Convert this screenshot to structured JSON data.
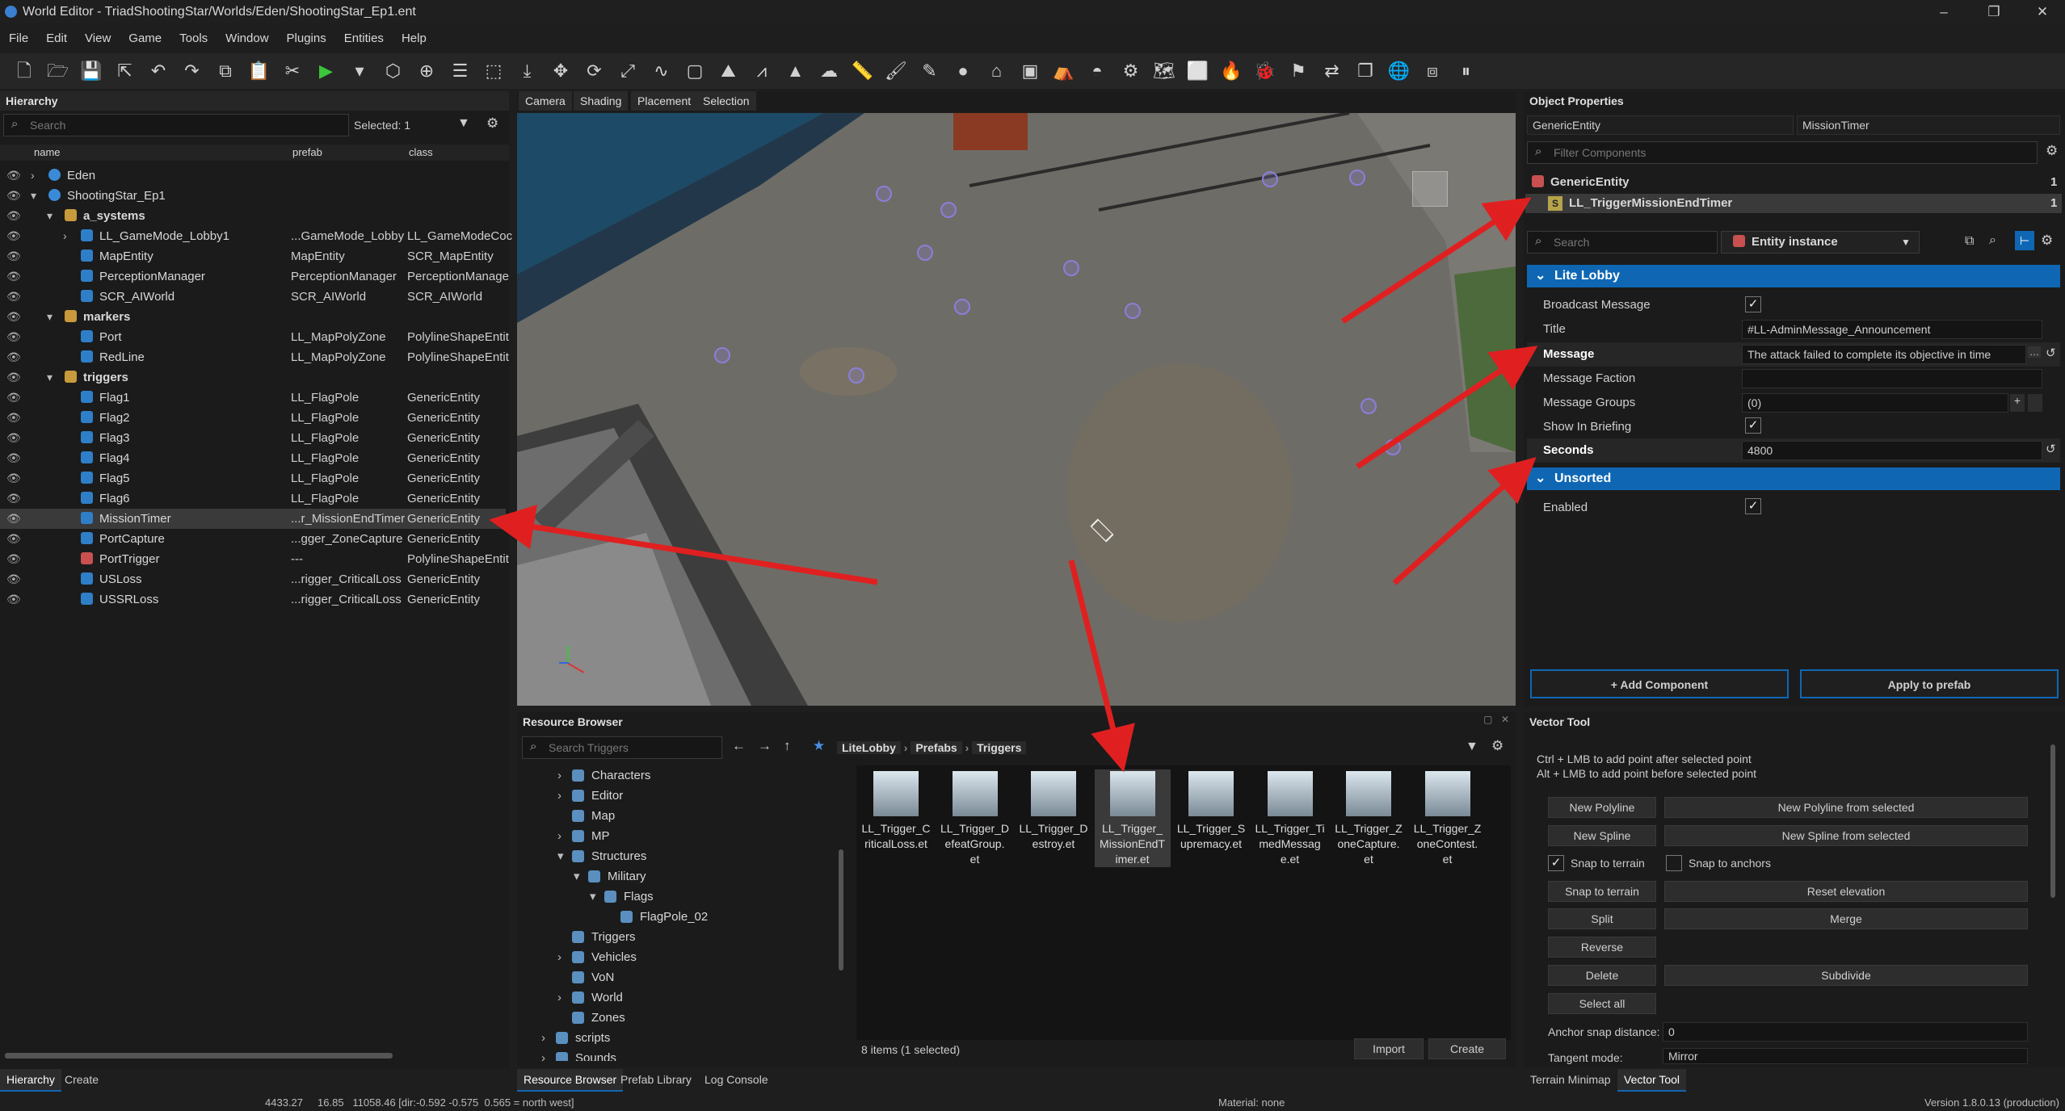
{
  "window": {
    "title": "World Editor - TriadShootingStar/Worlds/Eden/ShootingStar_Ep1.ent",
    "controls": [
      "–",
      "❐",
      "✕"
    ]
  },
  "menu": [
    "File",
    "Edit",
    "View",
    "Game",
    "Tools",
    "Window",
    "Plugins",
    "Entities",
    "Help"
  ],
  "toolbar_icons": [
    "new-file",
    "open-folder",
    "save",
    "export",
    "undo",
    "redo",
    "copy",
    "paste",
    "cut",
    "play",
    "play-options",
    "cube",
    "crosshair",
    "layers",
    "select-rect",
    "snap",
    "move",
    "rotate",
    "scale",
    "spline",
    "selection-box",
    "terrain",
    "mountain",
    "triangle",
    "weather",
    "ruler",
    "brush",
    "paint",
    "sphere",
    "house",
    "box",
    "tent",
    "dome",
    "gears",
    "map",
    "frame",
    "fire",
    "bug",
    "flag",
    "arrows",
    "windows",
    "globe",
    "stack",
    "pause"
  ],
  "hierarchy": {
    "title": "Hierarchy",
    "search_placeholder": "Search",
    "selected": "Selected: 1",
    "columns": [
      "name",
      "prefab",
      "class"
    ],
    "rows": [
      {
        "name": "Eden",
        "prefab": "",
        "class": "",
        "icon": "globe",
        "depth": 0,
        "arrow": "›"
      },
      {
        "name": "ShootingStar_Ep1",
        "prefab": "",
        "class": "",
        "icon": "globe",
        "depth": 0,
        "arrow": "▾"
      },
      {
        "name": "a_systems",
        "prefab": "",
        "class": "",
        "icon": "folder",
        "depth": 1,
        "arrow": "▾"
      },
      {
        "name": "LL_GameMode_Lobby1",
        "prefab": "...GameMode_Lobby",
        "class": "LL_GameModeCoc",
        "icon": "cube",
        "depth": 2,
        "arrow": "›"
      },
      {
        "name": "MapEntity",
        "prefab": "MapEntity",
        "class": "SCR_MapEntity",
        "icon": "cube",
        "depth": 2,
        "arrow": ""
      },
      {
        "name": "PerceptionManager",
        "prefab": "PerceptionManager",
        "class": "PerceptionManage",
        "icon": "cube",
        "depth": 2,
        "arrow": ""
      },
      {
        "name": "SCR_AIWorld",
        "prefab": "SCR_AIWorld",
        "class": "SCR_AIWorld",
        "icon": "cube",
        "depth": 2,
        "arrow": ""
      },
      {
        "name": "markers",
        "prefab": "",
        "class": "",
        "icon": "folder",
        "depth": 1,
        "arrow": "▾"
      },
      {
        "name": "Port",
        "prefab": "LL_MapPolyZone",
        "class": "PolylineShapeEntit",
        "icon": "cube",
        "depth": 2,
        "arrow": ""
      },
      {
        "name": "RedLine",
        "prefab": "LL_MapPolyZone",
        "class": "PolylineShapeEntit",
        "icon": "cube",
        "depth": 2,
        "arrow": ""
      },
      {
        "name": "triggers",
        "prefab": "",
        "class": "",
        "icon": "folder",
        "depth": 1,
        "arrow": "▾"
      },
      {
        "name": "Flag1",
        "prefab": "LL_FlagPole",
        "class": "GenericEntity",
        "icon": "cube",
        "depth": 2,
        "arrow": ""
      },
      {
        "name": "Flag2",
        "prefab": "LL_FlagPole",
        "class": "GenericEntity",
        "icon": "cube",
        "depth": 2,
        "arrow": ""
      },
      {
        "name": "Flag3",
        "prefab": "LL_FlagPole",
        "class": "GenericEntity",
        "icon": "cube",
        "depth": 2,
        "arrow": ""
      },
      {
        "name": "Flag4",
        "prefab": "LL_FlagPole",
        "class": "GenericEntity",
        "icon": "cube",
        "depth": 2,
        "arrow": ""
      },
      {
        "name": "Flag5",
        "prefab": "LL_FlagPole",
        "class": "GenericEntity",
        "icon": "cube",
        "depth": 2,
        "arrow": ""
      },
      {
        "name": "Flag6",
        "prefab": "LL_FlagPole",
        "class": "GenericEntity",
        "icon": "cube",
        "depth": 2,
        "arrow": ""
      },
      {
        "name": "MissionTimer",
        "prefab": "...r_MissionEndTimer",
        "class": "GenericEntity",
        "icon": "cube",
        "depth": 2,
        "arrow": "",
        "selected": true
      },
      {
        "name": "PortCapture",
        "prefab": "...gger_ZoneCapture",
        "class": "GenericEntity",
        "icon": "cube",
        "depth": 2,
        "arrow": ""
      },
      {
        "name": "PortTrigger",
        "prefab": "---",
        "class": "PolylineShapeEntit",
        "icon": "red",
        "depth": 2,
        "arrow": ""
      },
      {
        "name": "USLoss",
        "prefab": "...rigger_CriticalLoss",
        "class": "GenericEntity",
        "icon": "cube",
        "depth": 2,
        "arrow": ""
      },
      {
        "name": "USSRLoss",
        "prefab": "...rigger_CriticalLoss",
        "class": "GenericEntity",
        "icon": "cube",
        "depth": 2,
        "arrow": ""
      }
    ],
    "bottom_tabs": [
      "Hierarchy",
      "Create"
    ]
  },
  "viewport": {
    "tabs": [
      "Camera",
      "Shading",
      "Placement",
      "Selection"
    ]
  },
  "properties": {
    "title": "Object Properties",
    "entity_type": "GenericEntity",
    "entity_name": "MissionTimer",
    "filter_placeholder": "Filter Components",
    "components": [
      {
        "name": "GenericEntity",
        "count": "1"
      },
      {
        "name": "LL_TriggerMissionEndTimer",
        "count": "1",
        "badge": "S"
      }
    ],
    "search_placeholder": "Search",
    "instance_mode": "Entity instance",
    "section_lobby": "Lite Lobby",
    "section_unsorted": "Unsorted",
    "labels": {
      "broadcast": "Broadcast Message",
      "title": "Title",
      "message": "Message",
      "faction": "Message Faction",
      "groups": "Message Groups",
      "briefing": "Show In Briefing",
      "seconds": "Seconds",
      "enabled": "Enabled"
    },
    "values": {
      "title": "#LL-AdminMessage_Announcement",
      "message": "The attack failed to complete its objective in time",
      "faction": "",
      "groups": "(0)",
      "seconds": "4800"
    },
    "add_component": "+ Add Component",
    "apply_prefab": "Apply to prefab"
  },
  "resource_browser": {
    "title": "Resource Browser",
    "search_placeholder": "Search Triggers",
    "breadcrumb": [
      "LiteLobby",
      "Prefabs",
      "Triggers"
    ],
    "tree": [
      {
        "label": "Characters",
        "depth": 1,
        "arrow": "›"
      },
      {
        "label": "Editor",
        "depth": 1,
        "arrow": "›"
      },
      {
        "label": "Map",
        "depth": 1,
        "arrow": ""
      },
      {
        "label": "MP",
        "depth": 1,
        "arrow": "›"
      },
      {
        "label": "Structures",
        "depth": 1,
        "arrow": "▾"
      },
      {
        "label": "Military",
        "depth": 2,
        "arrow": "▾"
      },
      {
        "label": "Flags",
        "depth": 3,
        "arrow": "▾"
      },
      {
        "label": "FlagPole_02",
        "depth": 4,
        "arrow": ""
      },
      {
        "label": "Triggers",
        "depth": 1,
        "arrow": "",
        "selected": true
      },
      {
        "label": "Vehicles",
        "depth": 1,
        "arrow": "›"
      },
      {
        "label": "VoN",
        "depth": 1,
        "arrow": ""
      },
      {
        "label": "World",
        "depth": 1,
        "arrow": "›"
      },
      {
        "label": "Zones",
        "depth": 1,
        "arrow": ""
      },
      {
        "label": "scripts",
        "depth": 0,
        "arrow": "›"
      },
      {
        "label": "Sounds",
        "depth": 0,
        "arrow": "›"
      }
    ],
    "assets": [
      {
        "l1": "LL_Trigger_C",
        "l2": "riticalLoss.et",
        "l3": ""
      },
      {
        "l1": "LL_Trigger_D",
        "l2": "efeatGroup.",
        "l3": "et"
      },
      {
        "l1": "LL_Trigger_D",
        "l2": "estroy.et",
        "l3": ""
      },
      {
        "l1": "LL_Trigger_",
        "l2": "MissionEndT",
        "l3": "imer.et",
        "selected": true
      },
      {
        "l1": "LL_Trigger_S",
        "l2": "upremacy.et",
        "l3": ""
      },
      {
        "l1": "LL_Trigger_Ti",
        "l2": "medMessag",
        "l3": "e.et"
      },
      {
        "l1": "LL_Trigger_Z",
        "l2": "oneCapture.",
        "l3": "et"
      },
      {
        "l1": "LL_Trigger_Z",
        "l2": "oneContest.",
        "l3": "et"
      }
    ],
    "count": "8 items (1 selected)",
    "import": "Import",
    "create": "Create",
    "bottom_tabs": [
      "Resource Browser",
      "Prefab Library",
      "Log Console"
    ]
  },
  "vector_tool": {
    "title": "Vector Tool",
    "hint1": "Ctrl + LMB to add point after selected point",
    "hint2": "Alt + LMB to add point before selected point",
    "buttons": {
      "new_polyline": "New Polyline",
      "new_polyline_sel": "New Polyline from selected",
      "new_spline": "New Spline",
      "new_spline_sel": "New Spline from selected",
      "snap_terrain_chk": "Snap to terrain",
      "snap_anchors_chk": "Snap to anchors",
      "snap_terrain": "Snap to terrain",
      "reset_elev": "Reset elevation",
      "split": "Split",
      "merge": "Merge",
      "reverse": "Reverse",
      "delete": "Delete",
      "subdivide": "Subdivide",
      "select_all": "Select all"
    },
    "anchor_label": "Anchor snap distance:",
    "anchor_value": "0",
    "tangent_label": "Tangent mode:",
    "tangent_value": "Mirror",
    "bottom_tabs": [
      "Terrain Minimap",
      "Vector Tool"
    ]
  },
  "status": {
    "coords": "4433.27     16.85   11058.46 [dir:-0.592 -0.575  0.565 = north west]",
    "material": "Material: none",
    "version": "Version 1.8.0.13 (production)"
  },
  "colors": {
    "accent": "#0f67b4",
    "annotation": "#e02020",
    "selected_row": "#3a3a3a"
  }
}
